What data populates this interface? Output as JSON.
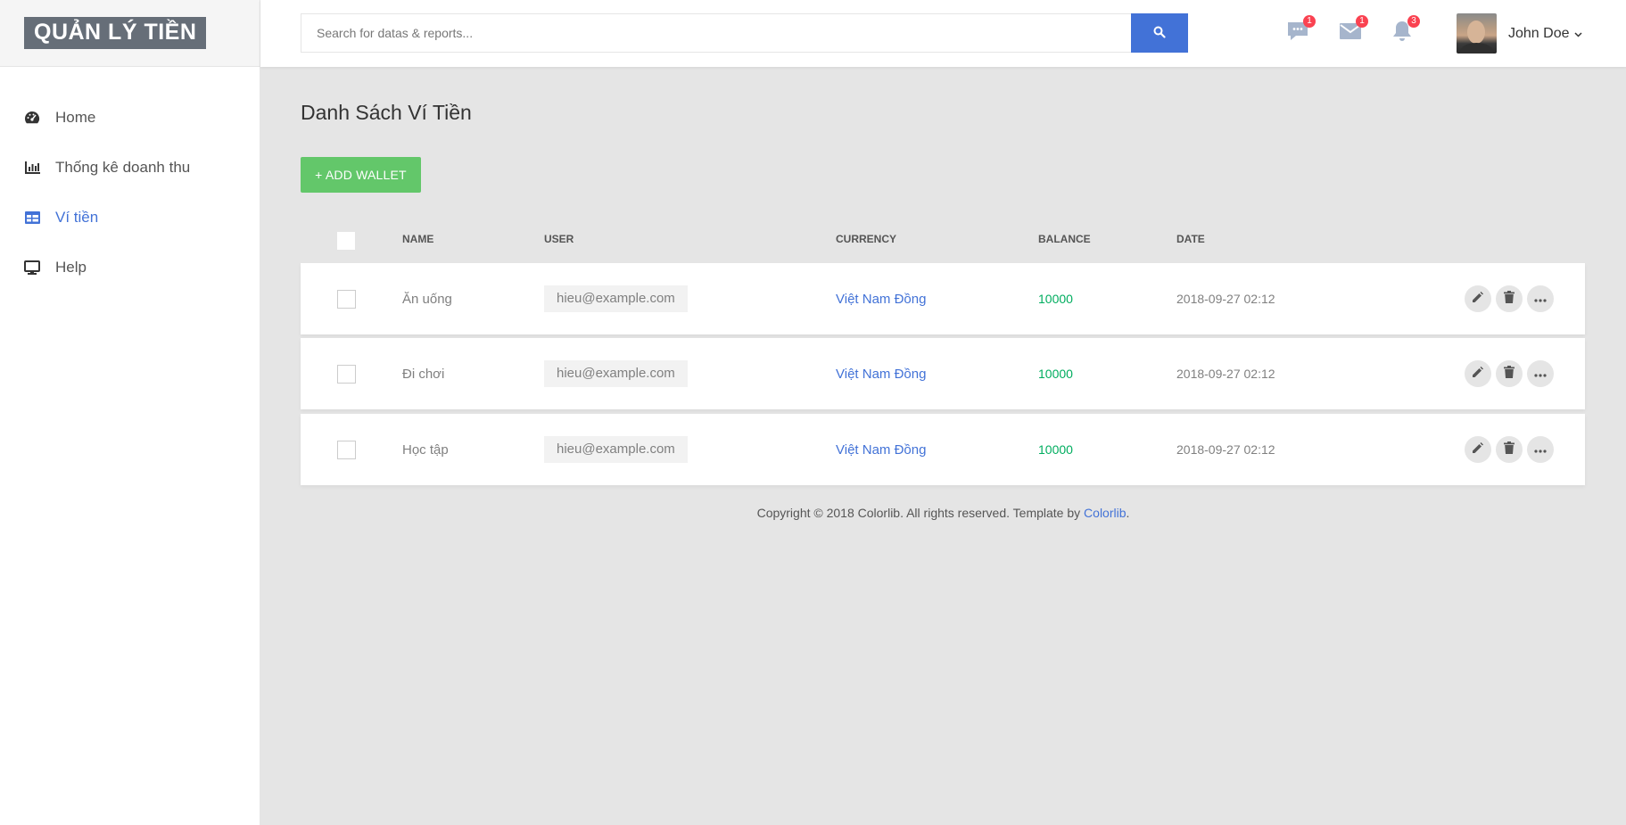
{
  "brand": {
    "logo_text": "QUẢN LÝ TIỀN"
  },
  "sidebar": {
    "items": [
      {
        "label": "Home",
        "icon": "tachometer-icon",
        "active": false
      },
      {
        "label": "Thống kê doanh thu",
        "icon": "bar-chart-icon",
        "active": false
      },
      {
        "label": "Ví tiền",
        "icon": "table-icon",
        "active": true
      },
      {
        "label": "Help",
        "icon": "desktop-icon",
        "active": false
      }
    ]
  },
  "header": {
    "search_placeholder": "Search for datas & reports...",
    "notifications": [
      {
        "icon": "comment-icon",
        "count": "1"
      },
      {
        "icon": "email-icon",
        "count": "1"
      },
      {
        "icon": "bell-icon",
        "count": "3"
      }
    ],
    "user_name": "John Doe"
  },
  "main": {
    "title": "Danh Sách Ví Tiền",
    "add_button": "+ ADD WALLET",
    "columns": [
      "NAME",
      "USER",
      "CURRENCY",
      "BALANCE",
      "DATE"
    ],
    "rows": [
      {
        "name": "Ăn uống",
        "user": "hieu@example.com",
        "currency": "Việt Nam Đồng",
        "balance": "10000",
        "date": "2018-09-27 02:12"
      },
      {
        "name": "Đi chơi",
        "user": "hieu@example.com",
        "currency": "Việt Nam Đồng",
        "balance": "10000",
        "date": "2018-09-27 02:12"
      },
      {
        "name": "Học tập",
        "user": "hieu@example.com",
        "currency": "Việt Nam Đồng",
        "balance": "10000",
        "date": "2018-09-27 02:12"
      }
    ]
  },
  "footer": {
    "text": "Copyright © 2018 Colorlib. All rights reserved. Template by ",
    "link": "Colorlib",
    "suffix": "."
  },
  "colors": {
    "accent": "#4272d7",
    "add_button": "#63c76a",
    "balance": "#00ad5f",
    "badge": "#fa4251",
    "logo_bg": "#666e78"
  }
}
